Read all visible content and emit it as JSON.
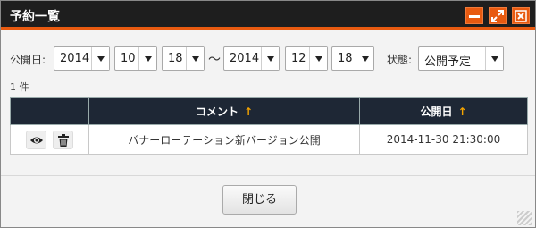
{
  "window": {
    "title": "予約一覧"
  },
  "filters": {
    "date_label": "公開日:",
    "from": {
      "year": "2014",
      "month": "10",
      "day": "18"
    },
    "separator": "～",
    "to": {
      "year": "2014",
      "month": "12",
      "day": "18"
    },
    "status_label": "状態:",
    "status_value": "公開予定"
  },
  "result_count": "1 件",
  "table": {
    "columns": [
      {
        "label": "",
        "sort": ""
      },
      {
        "label": "コメント",
        "sort": "↑"
      },
      {
        "label": "公開日",
        "sort": "↑"
      }
    ],
    "rows": [
      {
        "comment": "バナーローテーション新バージョン公開",
        "date": "2014-11-30 21:30:00"
      }
    ]
  },
  "footer": {
    "close_label": "閉じる"
  },
  "icons": {
    "minimize": "minimize-icon",
    "maximize": "maximize-icon",
    "close": "close-icon",
    "view": "eye-icon",
    "delete": "trash-icon"
  },
  "colors": {
    "accent": "#e85a10",
    "header_bg": "#1e2735",
    "sort_arrow": "#f4a300"
  }
}
